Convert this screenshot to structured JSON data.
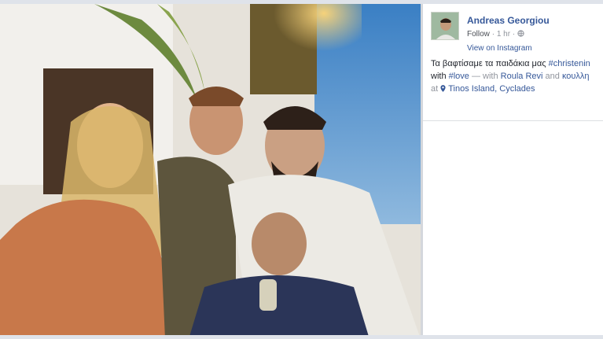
{
  "post": {
    "author": "Andreas Georgiou",
    "follow": "Follow",
    "dot": "·",
    "time": "1 hr",
    "dot2": "·",
    "view_on_instagram": "View on Instagram"
  },
  "caption": {
    "line1_text": "Τα βαφτίσαμε τα παιδάκια μας ",
    "line1_tag": "#christenin",
    "line2_with": "with ",
    "line2_tag": "#love",
    "line2_dash": " — with ",
    "person1": "Roula Revi",
    "and": " and ",
    "person2": "κουλλη",
    "line3_at": "at ",
    "place": "Tinos Island, Cyclades"
  },
  "icons": {
    "privacy": "globe-icon",
    "location": "map-pin-icon"
  },
  "colors": {
    "link": "#365899",
    "meta": "#90949c",
    "text": "#1d2129"
  }
}
